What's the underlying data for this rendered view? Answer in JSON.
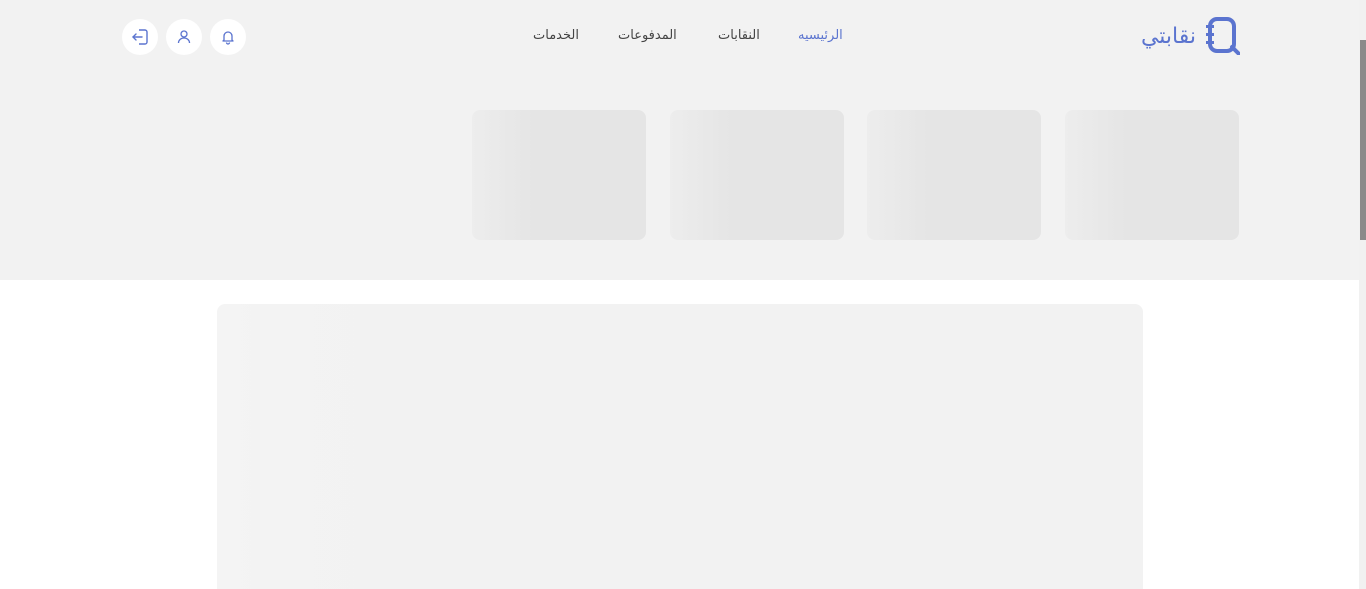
{
  "header": {
    "logo_text": "نقابتي",
    "brand_color": "#5b74cf",
    "nav": {
      "home": "الرئيسيه",
      "unions": "النقابات",
      "payments": "المدفوعات",
      "services": "الخدمات"
    },
    "icons": {
      "notifications": "bell-icon",
      "profile": "user-icon",
      "logout": "logout-icon"
    }
  },
  "loading_state": {
    "skeleton_cards": 4,
    "main_skeleton": true
  }
}
